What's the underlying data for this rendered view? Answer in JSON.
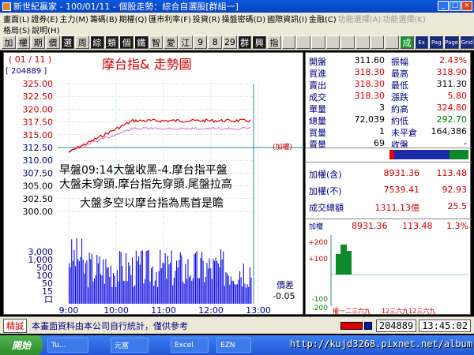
{
  "window": {
    "title": "新世紀贏家 - 100/01/11 - 個股走勢：綜合自選股[群組一]"
  },
  "menu": {
    "row1": [
      "畫面(L)",
      "證券(E)",
      "主力(M)",
      "籌碼(B)",
      "期權(Q)",
      "匯市利率(F)",
      "投資(R)",
      "操盤密碼(D)",
      "國際資訊(I)",
      "金融(C)",
      "功能選擇(A)",
      "功能選擇(K)"
    ],
    "row2": [
      "格局(S)",
      "說明(H)"
    ]
  },
  "toolbar": [
    "加",
    "權",
    "期",
    "價",
    "選",
    "周",
    "綜",
    "類",
    "個",
    "鐵",
    "智",
    "愛",
    "江",
    "9",
    "8",
    "29",
    "群",
    "興",
    "指",
    "",
    "",
    "",
    "",
    "",
    "",
    "",
    "",
    "成",
    "Ex",
    "Pag",
    "Page",
    "Grid"
  ],
  "chart": {
    "date_label": "( 01 / 11 )",
    "volume_label": "[ 204889 ]",
    "title": "摩台指&  走勢圖",
    "price_ticks": [
      "325.00",
      "322.50",
      "320.00",
      "317.50",
      "315.00",
      "312.50",
      "310.00",
      "307.50",
      "305.00",
      "302.50",
      "300.00"
    ],
    "vol_ticks": [
      "3,000",
      "1,000",
      "500",
      "100",
      "50",
      "15",
      "口"
    ],
    "time_ticks": [
      "9:00",
      "10:00",
      "11:00",
      "12:00",
      "13:00"
    ],
    "index_label": "(加權)",
    "spread_label": "價差",
    "spread_value": "-0.05",
    "annotation_lines": [
      "早盤09:14大盤收黑-4.摩台指平盤",
      "大盤未穿頭.摩台指先穿頭.尾盤拉高",
      "大盤多空以摩台指為馬首是瞻"
    ],
    "colors": {
      "price": "#e00000",
      "index": "#d070d0",
      "volume": "#1010e0",
      "grid": "#7fb0b0"
    }
  },
  "quote": {
    "rows": [
      {
        "l1": "開盤",
        "v1": "311.60",
        "l2": "振幅",
        "v2": "2.43%",
        "c1": "#000",
        "c2": "#d00"
      },
      {
        "l1": "買進",
        "v1": "318.30",
        "l2": "最高",
        "v2": "318.90",
        "c1": "#d00",
        "c2": "#d00"
      },
      {
        "l1": "賣出",
        "v1": "318.30",
        "l2": "最低",
        "v2": "311.30",
        "c1": "#d00",
        "c2": "#000"
      },
      {
        "l1": "成交",
        "v1": "318.30",
        "l2": "漲跌",
        "v2": "5.80",
        "c1": "#d00",
        "c2": "#d00"
      },
      {
        "l1": "單量",
        "v1": "3",
        "l2": "約高",
        "v2": "324.80",
        "c1": "#000",
        "c2": "#d00"
      },
      {
        "l1": "總量",
        "v1": "72,039",
        "l2": "約低",
        "v2": "292.70",
        "c1": "#000",
        "c2": "#008000"
      },
      {
        "l1": "買量",
        "v1": "1",
        "l2": "未平倉",
        "v2": "164,386",
        "c1": "#000",
        "c2": "#000"
      },
      {
        "l1": "賣量",
        "v1": "69",
        "l2": "收盤",
        "v2": "-",
        "c1": "#000",
        "c2": "#000"
      }
    ],
    "index_rows": [
      {
        "label": "加權(含)",
        "value": "8931.36",
        "change": "113.48"
      },
      {
        "label": "加權(不)",
        "value": "7539.41",
        "change": "92.93"
      },
      {
        "label": "成交總額",
        "value": "1311.13億",
        "change": "25.5"
      }
    ]
  },
  "mini": {
    "label": "加權",
    "value": "8931.36",
    "change": "113.48",
    "pct": "1.3%",
    "y_ticks": [
      "+200",
      "+100",
      "-100",
      "-200"
    ],
    "x_labels": "權一二三六九",
    "x_labels2": "12三六九12三六九"
  },
  "status": {
    "button": "精誠",
    "note": "本畫面資料由本公司自行統計，僅供參考",
    "volume": "204889",
    "time": "13:45:02"
  },
  "taskbar": {
    "start": "開始",
    "tasks": [
      "Tu...",
      "元富",
      "Excel",
      "EZN"
    ],
    "watermark": "http://kujd3268.pixnet.net/album"
  }
}
